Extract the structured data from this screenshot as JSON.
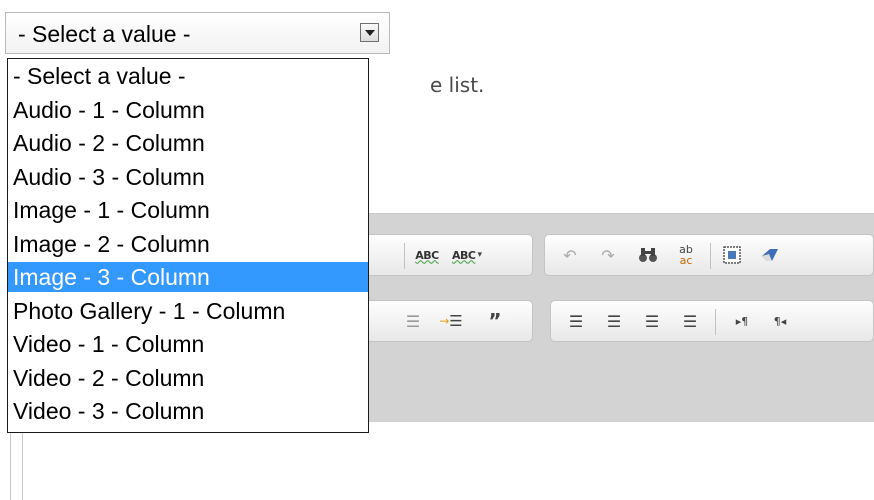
{
  "select": {
    "current_value": "- Select a value -"
  },
  "dropdown": {
    "options": [
      "- Select a value -",
      "Audio - 1 - Column",
      "Audio - 2 - Column",
      "Audio - 3 - Column",
      "Image - 1 - Column",
      "Image - 2 - Column",
      "Image - 3 - Column",
      "Photo Gallery - 1 - Column",
      "Video - 1 - Column",
      "Video - 2 - Column",
      "Video - 3 - Column"
    ],
    "highlighted_index": 6
  },
  "page": {
    "help_text_fragment": "e list."
  },
  "toolbar": {
    "spellcheck_label": "ABC",
    "spellcheck_menu_label": "ABC"
  },
  "colors": {
    "highlight": "#3399ff",
    "toolbar_bg": "#d3d3d3"
  }
}
